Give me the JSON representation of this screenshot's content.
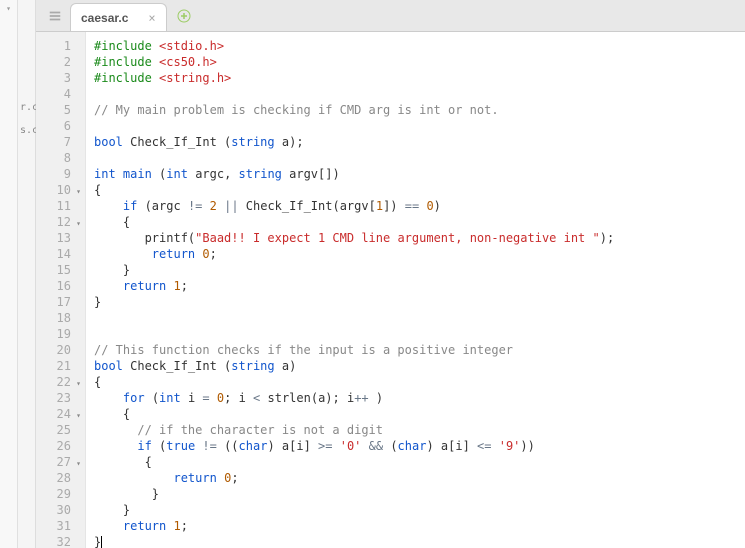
{
  "sidebar_files": [
    "r.c",
    "s.c"
  ],
  "tab": {
    "title": "caesar.c"
  },
  "gutter": [
    {
      "n": "1"
    },
    {
      "n": "2"
    },
    {
      "n": "3"
    },
    {
      "n": "4"
    },
    {
      "n": "5"
    },
    {
      "n": "6"
    },
    {
      "n": "7"
    },
    {
      "n": "8"
    },
    {
      "n": "9"
    },
    {
      "n": "10",
      "fold": true
    },
    {
      "n": "11"
    },
    {
      "n": "12",
      "fold": true
    },
    {
      "n": "13"
    },
    {
      "n": "14"
    },
    {
      "n": "15"
    },
    {
      "n": "16"
    },
    {
      "n": "17"
    },
    {
      "n": "18"
    },
    {
      "n": "19"
    },
    {
      "n": "20"
    },
    {
      "n": "21"
    },
    {
      "n": "22",
      "fold": true
    },
    {
      "n": "23"
    },
    {
      "n": "24",
      "fold": true
    },
    {
      "n": "25"
    },
    {
      "n": "26"
    },
    {
      "n": "27",
      "fold": true
    },
    {
      "n": "28"
    },
    {
      "n": "29"
    },
    {
      "n": "30"
    },
    {
      "n": "31"
    },
    {
      "n": "32"
    }
  ],
  "code": [
    [
      [
        "c-green",
        "#include "
      ],
      [
        "c-red",
        "<stdio.h>"
      ]
    ],
    [
      [
        "c-green",
        "#include "
      ],
      [
        "c-red",
        "<cs50.h>"
      ]
    ],
    [
      [
        "c-green",
        "#include "
      ],
      [
        "c-red",
        "<string.h>"
      ]
    ],
    [
      [
        "",
        ""
      ]
    ],
    [
      [
        "c-comment",
        "// My main problem is checking if CMD arg is int or not."
      ]
    ],
    [
      [
        "",
        ""
      ]
    ],
    [
      [
        "c-type",
        "bool"
      ],
      [
        "",
        " Check_If_Int ("
      ],
      [
        "c-type",
        "string"
      ],
      [
        "",
        " a);"
      ]
    ],
    [
      [
        "",
        ""
      ]
    ],
    [
      [
        "c-type",
        "int"
      ],
      [
        "",
        " "
      ],
      [
        "c-kw",
        "main"
      ],
      [
        "",
        " ("
      ],
      [
        "c-type",
        "int"
      ],
      [
        "",
        " argc, "
      ],
      [
        "c-type",
        "string"
      ],
      [
        "",
        " argv[])"
      ]
    ],
    [
      [
        "",
        "{"
      ]
    ],
    [
      [
        "",
        "    "
      ],
      [
        "c-kw",
        "if"
      ],
      [
        "",
        " (argc "
      ],
      [
        "c-op",
        "!="
      ],
      [
        "",
        " "
      ],
      [
        "c-num",
        "2"
      ],
      [
        "",
        " "
      ],
      [
        "c-op",
        "||"
      ],
      [
        "",
        " Check_If_Int(argv["
      ],
      [
        "c-num",
        "1"
      ],
      [
        "",
        "]) "
      ],
      [
        "c-op",
        "=="
      ],
      [
        "",
        " "
      ],
      [
        "c-num",
        "0"
      ],
      [
        "",
        ")"
      ]
    ],
    [
      [
        "",
        "    {"
      ]
    ],
    [
      [
        "",
        "       printf("
      ],
      [
        "c-red",
        "\"Baad!! I expect 1 CMD line argument, non-negative int \""
      ],
      [
        "",
        ");"
      ]
    ],
    [
      [
        "",
        "        "
      ],
      [
        "c-kw",
        "return"
      ],
      [
        "",
        " "
      ],
      [
        "c-num",
        "0"
      ],
      [
        "",
        ";"
      ]
    ],
    [
      [
        "",
        "    }"
      ]
    ],
    [
      [
        "",
        "    "
      ],
      [
        "c-kw",
        "return"
      ],
      [
        "",
        " "
      ],
      [
        "c-num",
        "1"
      ],
      [
        "",
        ";"
      ]
    ],
    [
      [
        "",
        "}"
      ]
    ],
    [
      [
        "",
        ""
      ]
    ],
    [
      [
        "",
        ""
      ]
    ],
    [
      [
        "c-comment",
        "// This function checks if the input is a positive integer"
      ]
    ],
    [
      [
        "c-type",
        "bool"
      ],
      [
        "",
        " Check_If_Int ("
      ],
      [
        "c-type",
        "string"
      ],
      [
        "",
        " a)"
      ]
    ],
    [
      [
        "",
        "{"
      ]
    ],
    [
      [
        "",
        "    "
      ],
      [
        "c-kw",
        "for"
      ],
      [
        "",
        " ("
      ],
      [
        "c-type",
        "int"
      ],
      [
        "",
        " i "
      ],
      [
        "c-op",
        "="
      ],
      [
        "",
        " "
      ],
      [
        "c-num",
        "0"
      ],
      [
        "",
        "; i "
      ],
      [
        "c-op",
        "<"
      ],
      [
        "",
        " strlen(a); i"
      ],
      [
        "c-op",
        "++"
      ],
      [
        "",
        " )"
      ]
    ],
    [
      [
        "",
        "    {"
      ]
    ],
    [
      [
        "",
        "      "
      ],
      [
        "c-comment",
        "// if the character is not a digit"
      ]
    ],
    [
      [
        "",
        "      "
      ],
      [
        "c-kw",
        "if"
      ],
      [
        "",
        " ("
      ],
      [
        "c-kw",
        "true"
      ],
      [
        "",
        " "
      ],
      [
        "c-op",
        "!="
      ],
      [
        "",
        " (("
      ],
      [
        "c-type",
        "char"
      ],
      [
        "",
        ") a[i] "
      ],
      [
        "c-op",
        ">="
      ],
      [
        "",
        " "
      ],
      [
        "c-red",
        "'0'"
      ],
      [
        "",
        " "
      ],
      [
        "c-op",
        "&&"
      ],
      [
        "",
        " ("
      ],
      [
        "c-type",
        "char"
      ],
      [
        "",
        ") a[i] "
      ],
      [
        "c-op",
        "<="
      ],
      [
        "",
        " "
      ],
      [
        "c-red",
        "'9'"
      ],
      [
        "",
        "))"
      ]
    ],
    [
      [
        "",
        "       {"
      ]
    ],
    [
      [
        "",
        "           "
      ],
      [
        "c-kw",
        "return"
      ],
      [
        "",
        " "
      ],
      [
        "c-num",
        "0"
      ],
      [
        "",
        ";"
      ]
    ],
    [
      [
        "",
        "        }"
      ]
    ],
    [
      [
        "",
        "    }"
      ]
    ],
    [
      [
        "",
        "    "
      ],
      [
        "c-kw",
        "return"
      ],
      [
        "",
        " "
      ],
      [
        "c-num",
        "1"
      ],
      [
        "",
        ";"
      ]
    ],
    [
      [
        "",
        "}"
      ]
    ]
  ]
}
